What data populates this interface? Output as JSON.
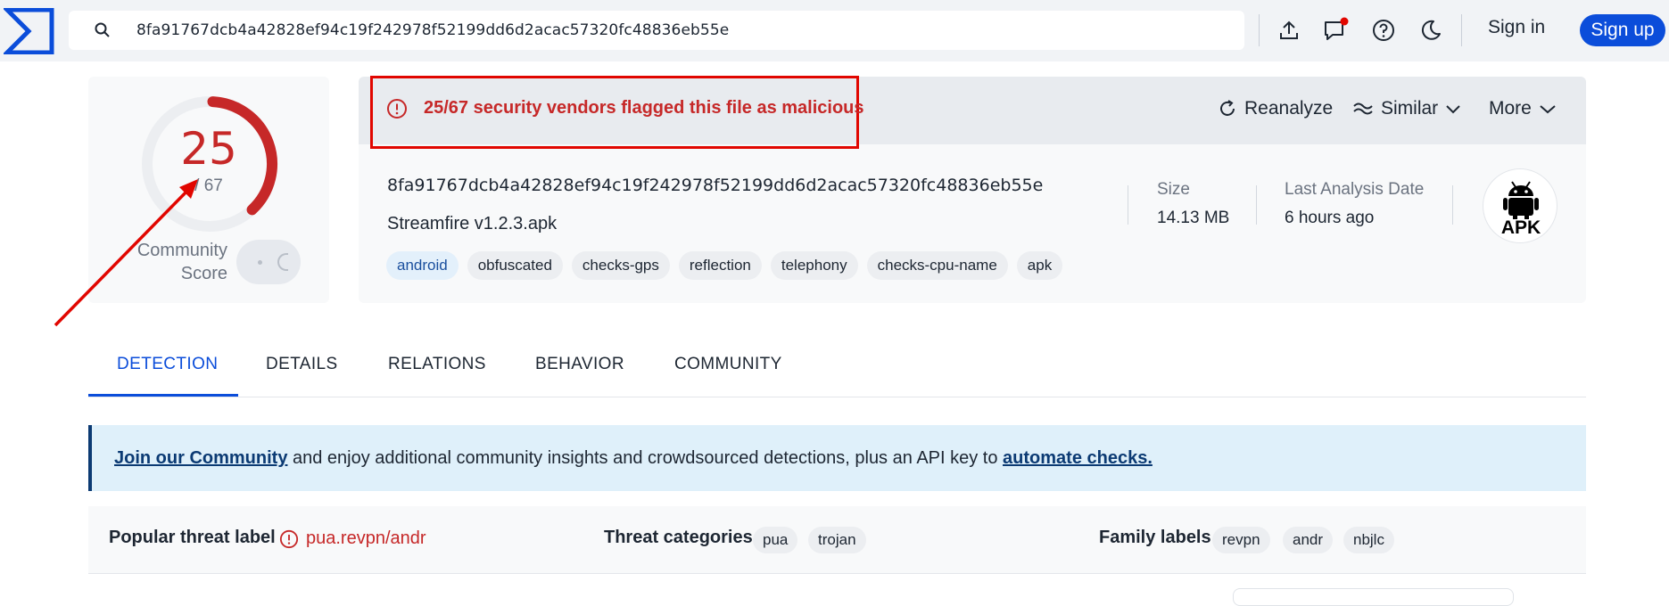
{
  "search": {
    "value": "8fa91767dcb4a42828ef94c19f242978f52199dd6d2acac57320fc48836eb55e"
  },
  "header": {
    "sign_in": "Sign in",
    "sign_up": "Sign up"
  },
  "score": {
    "detections": "25",
    "total": "/ 67",
    "community_label_line1": "Community",
    "community_label_line2": "Score"
  },
  "alert": {
    "text": "25/67 security vendors flagged this file as malicious"
  },
  "actions": {
    "reanalyze": "Reanalyze",
    "similar": "Similar",
    "more": "More"
  },
  "file": {
    "hash": "8fa91767dcb4a42828ef94c19f242978f52199dd6d2acac57320fc48836eb55e",
    "name": "Streamfire v1.2.3.apk",
    "tags": [
      "android",
      "obfuscated",
      "checks-gps",
      "reflection",
      "telephony",
      "checks-cpu-name",
      "apk"
    ],
    "size_label": "Size",
    "size_value": "14.13 MB",
    "date_label": "Last Analysis Date",
    "date_value": "6 hours ago",
    "type_badge": "APK"
  },
  "tabs": [
    "DETECTION",
    "DETAILS",
    "RELATIONS",
    "BEHAVIOR",
    "COMMUNITY"
  ],
  "banner": {
    "link1": "Join our Community",
    "middle": " and enjoy additional community insights and crowdsourced detections, plus an API key to ",
    "link2": "automate checks."
  },
  "threat": {
    "popular_label": "Popular threat label",
    "popular_value": "pua.revpn/andr",
    "categories_label": "Threat categories",
    "categories": [
      "pua",
      "trojan"
    ],
    "family_label": "Family labels",
    "families": [
      "revpn",
      "andr",
      "nbjlc"
    ]
  },
  "colors": {
    "accent": "#0b4dda",
    "malicious": "#c62828",
    "annotation": "#e10600"
  }
}
